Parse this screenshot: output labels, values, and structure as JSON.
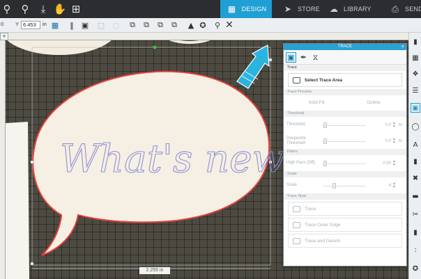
{
  "toolbar": {
    "icons": [
      "zoom-icon",
      "zoom-fit-icon",
      "move-icon",
      "pan-icon",
      "grid-icon"
    ],
    "tabs": [
      {
        "label": "DESIGN",
        "icon": "design-icon",
        "active": true
      },
      {
        "label": "STORE",
        "icon": "store-icon",
        "active": false
      },
      {
        "label": "LIBRARY",
        "icon": "library-icon",
        "active": false
      },
      {
        "label": "SEND",
        "icon": "send-icon",
        "active": false
      }
    ]
  },
  "subbar": {
    "x_value": "0",
    "y_label": "Y",
    "y_value": "6.453",
    "unit": "in"
  },
  "canvas": {
    "bubble_text": "What's new?",
    "dimension_label": "2.255 in",
    "colors": {
      "mat": "#4d4a41",
      "bubble_fill": "#f6efe3",
      "bubble_outline": "#e5403d",
      "text": "#8c93d8",
      "arrow": "#2bb4e0"
    }
  },
  "trace_panel": {
    "title": "TRACE",
    "close": "×",
    "sections": {
      "trace": "Trace",
      "trace_preview": "Trace Preview",
      "threshold": "Threshold",
      "filters": "Filters",
      "scale": "Scale",
      "trace_style": "Trace Style"
    },
    "select_trace_area": "Select Trace Area",
    "solid_fill": "Solid Fill",
    "outline": "Outline",
    "threshold_label": "Threshold",
    "threshold_value": "0.0",
    "despeckle_label": "Despeckle Threshold",
    "despeckle_value": "0.0",
    "high_pass_label": "High Pass (Off)",
    "high_pass_value": "0.00",
    "scale_label": "Scale",
    "scale_value": "4",
    "percent": "%",
    "trace_btn": "Trace",
    "trace_outer_edge": "Trace Outer Edge",
    "trace_and_detach": "Trace and Detach"
  }
}
